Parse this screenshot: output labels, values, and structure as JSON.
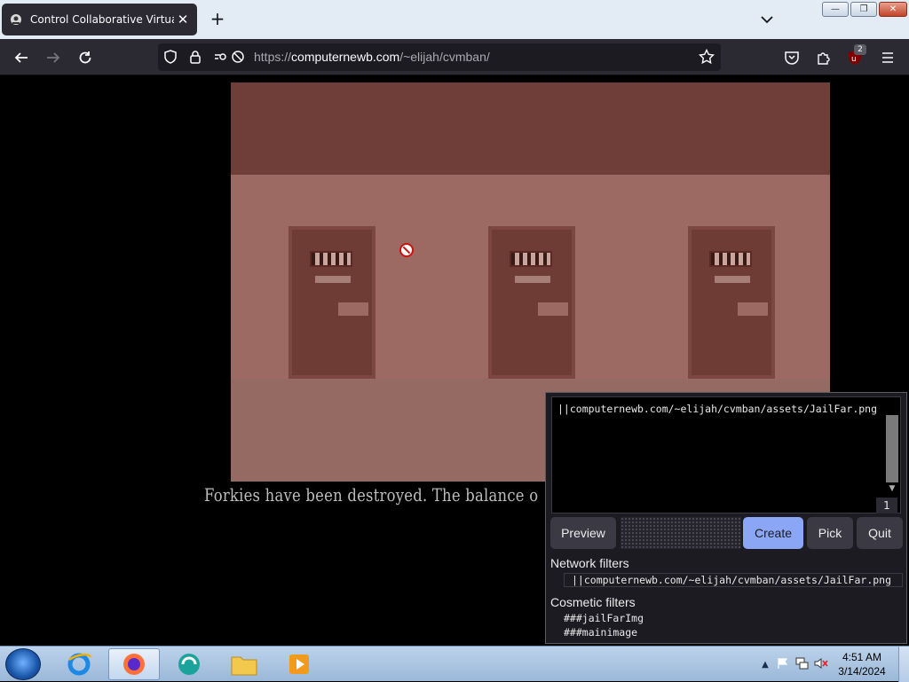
{
  "tab": {
    "title": "Control Collaborative Virtual M",
    "close": "✕"
  },
  "newtab": "+",
  "window": {
    "minimize": "—",
    "restore": "❐",
    "close": "✕"
  },
  "address": {
    "scheme": "https://",
    "host": "computernewb.com",
    "path": "/~elijah/cvmban/"
  },
  "extension_badge": "2",
  "game": {
    "caption": "Forkies have been destroyed. The balance o"
  },
  "picker": {
    "filter_text": "||computernewb.com/~elijah/cvmban/assets/JailFar.png",
    "count": "1",
    "buttons": {
      "preview": "Preview",
      "create": "Create",
      "pick": "Pick",
      "quit": "Quit"
    },
    "network_heading": "Network filters",
    "network_filters": [
      "||computernewb.com/~elijah/cvmban/assets/JailFar.png"
    ],
    "cosmetic_heading": "Cosmetic filters",
    "cosmetic_filters": [
      "###jailFarImg",
      "###mainimage"
    ]
  },
  "clock": {
    "time": "4:51 AM",
    "date": "3/14/2024"
  }
}
